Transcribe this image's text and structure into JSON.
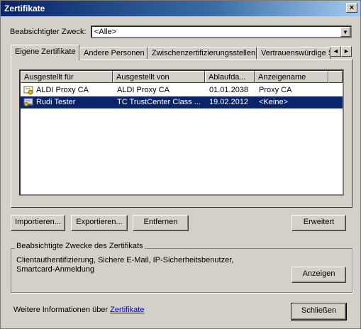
{
  "window": {
    "title": "Zertifikate",
    "close_glyph": "×"
  },
  "purpose": {
    "label": "Beabsichtigter Zweck:",
    "value": "<Alle>"
  },
  "tabs": [
    {
      "label": "Eigene Zertifikate"
    },
    {
      "label": "Andere Personen"
    },
    {
      "label": "Zwischenzertifizierungsstellen"
    },
    {
      "label": "Vertrauenswürdige Stamm"
    }
  ],
  "table": {
    "columns": [
      "Ausgestellt für",
      "Ausgestellt von",
      "Ablaufda...",
      "Anzeigename"
    ],
    "rows": [
      {
        "issued_to": "ALDI Proxy CA",
        "issued_by": "ALDI Proxy CA",
        "expires": "01.01.2038",
        "friendly_name": "Proxy CA",
        "icon": "certificate-icon"
      },
      {
        "issued_to": "Rudi Tester",
        "issued_by": "TC TrustCenter Class ...",
        "expires": "19.02.2012",
        "friendly_name": "<Keine>",
        "icon": "certificate-key-icon",
        "selected": true
      }
    ]
  },
  "buttons": {
    "import": "Importieren...",
    "export": "Exportieren...",
    "remove": "Entfernen",
    "advanced": "Erweitert",
    "view": "Anzeigen",
    "close": "Schließen"
  },
  "purposes_group": {
    "legend": "Beabsichtigte Zwecke des Zertifikats",
    "text_line1": "Clientauthentifizierung, Sichere E-Mail, IP-Sicherheitsbenutzer,",
    "text_line2": "Smartcard-Anmeldung"
  },
  "footer": {
    "text": "Weitere Informationen über",
    "link": "Zertifikate"
  },
  "colors": {
    "selection": "#0a246a",
    "face": "#d4d0c8",
    "link": "#0000cc"
  }
}
